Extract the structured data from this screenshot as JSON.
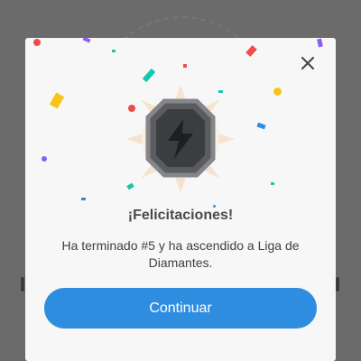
{
  "modal": {
    "title": "¡Felicitaciones!",
    "message": "Ha terminado #5 y ha ascendido a Liga de Diamantes.",
    "continue_label": "Continuar"
  },
  "icons": {
    "close": "close-icon",
    "badge": "diamond-league-badge-icon",
    "bolt": "lightning-bolt-icon"
  },
  "colors": {
    "button": "#2f8de0",
    "modal_background": "#f7f7f7",
    "title_text": "#4a4a4a",
    "body_text": "#404040",
    "badge_dark": "#3c3d40",
    "badge_border": "#707174"
  }
}
